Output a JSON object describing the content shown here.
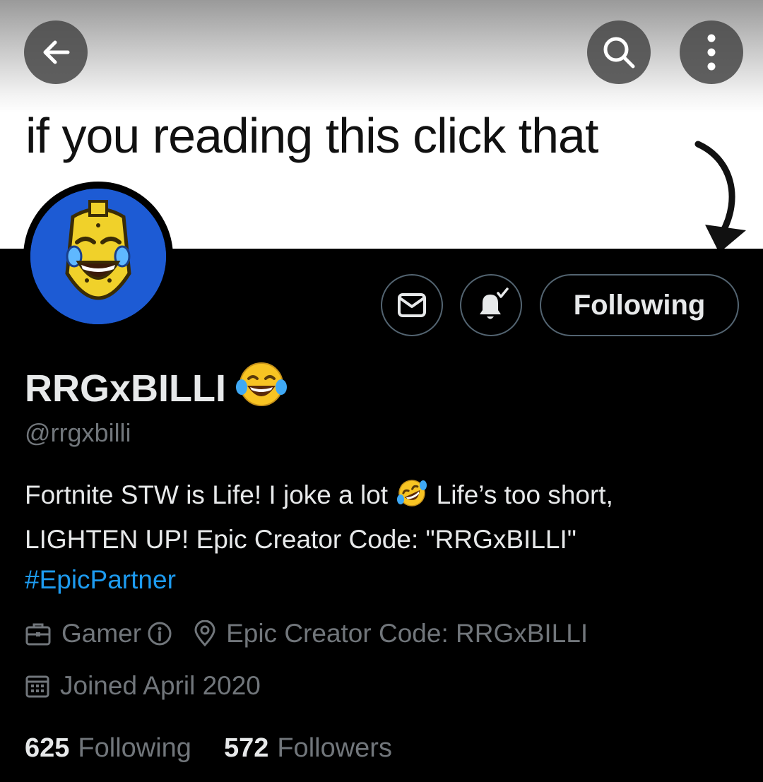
{
  "banner": {
    "text": "if you reading this click that"
  },
  "header": {
    "back_icon": "arrow-left-icon",
    "search_icon": "search-icon",
    "more_icon": "more-vertical-icon"
  },
  "profile": {
    "display_name": "RRGxBILLI",
    "name_emoji": "face-with-tears-of-joy",
    "handle": "@rrgxbilli",
    "bio": {
      "line1_a": "Fortnite STW is Life! I joke a lot",
      "line1_emoji": "rolling-on-the-floor-laughing",
      "line1_b": "Life’s too short,",
      "line2": "LIGHTEN UP! Epic Creator Code: \"RRGxBILLI\"",
      "hashtag": "#EpicPartner"
    },
    "category": "Gamer",
    "location": "Epic Creator Code: RRGxBILLI",
    "joined": "Joined April 2020",
    "following_count": "625",
    "following_label": "Following",
    "followers_count": "572",
    "followers_label": "Followers"
  },
  "actions": {
    "message_icon": "envelope-icon",
    "notify_icon": "bell-check-icon",
    "following_button": "Following"
  },
  "colors": {
    "background": "#000000",
    "text": "#e7e9ea",
    "muted": "#71767b",
    "link": "#1d9bf0",
    "border": "#536471",
    "avatar_bg": "#1d5bd4"
  }
}
